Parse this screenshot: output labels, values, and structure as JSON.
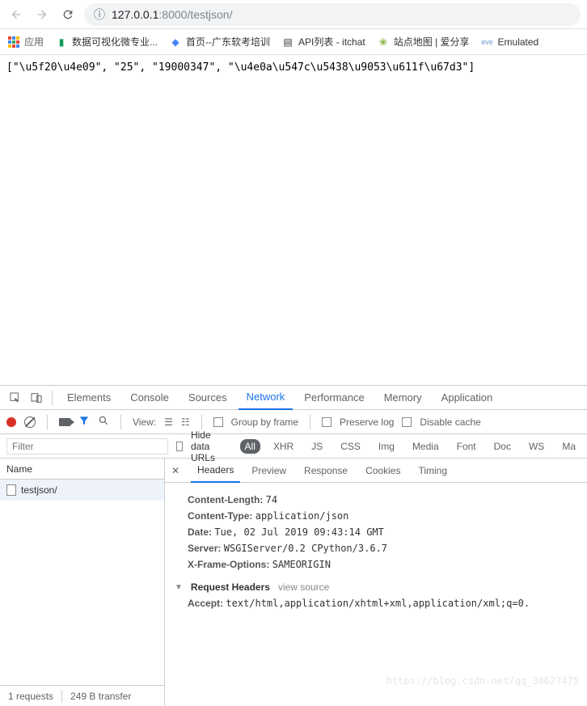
{
  "browser": {
    "url_host": "127.0.0.1",
    "url_path": ":8000/testjson/"
  },
  "bookmarks": {
    "apps_label": "应用",
    "items": [
      {
        "label": "数据可视化微专业...",
        "color": "#0f9d58"
      },
      {
        "label": "首页--广东软考培训",
        "color": "#4285f4"
      },
      {
        "label": "API列表 - itchat",
        "color": "#333"
      },
      {
        "label": "站点地图 | 爱分享",
        "color": "#8ab445"
      },
      {
        "label": "Emulated",
        "color": "#6b9bd2"
      }
    ]
  },
  "page_body": "[\"\\u5f20\\u4e09\", \"25\", \"19000347\", \"\\u4e0a\\u547c\\u5438\\u9053\\u611f\\u67d3\"]",
  "devtools": {
    "tabs": [
      "Elements",
      "Console",
      "Sources",
      "Network",
      "Performance",
      "Memory",
      "Application"
    ],
    "active_tab": "Network",
    "toolbar": {
      "view_label": "View:",
      "group_label": "Group by frame",
      "preserve_label": "Preserve log",
      "disable_label": "Disable cache"
    },
    "filter": {
      "placeholder": "Filter",
      "hide_urls": "Hide data URLs",
      "types": [
        "All",
        "XHR",
        "JS",
        "CSS",
        "Img",
        "Media",
        "Font",
        "Doc",
        "WS",
        "Ma"
      ]
    },
    "requests": {
      "header": "Name",
      "items": [
        "testjson/"
      ]
    },
    "detail_tabs": [
      "Headers",
      "Preview",
      "Response",
      "Cookies",
      "Timing"
    ],
    "headers": {
      "content_length": {
        "k": "Content-Length:",
        "v": "74"
      },
      "content_type": {
        "k": "Content-Type:",
        "v": "application/json"
      },
      "date": {
        "k": "Date:",
        "v": "Tue, 02 Jul 2019 09:43:14 GMT"
      },
      "server": {
        "k": "Server:",
        "v": "WSGIServer/0.2 CPython/3.6.7"
      },
      "xframe": {
        "k": "X-Frame-Options:",
        "v": "SAMEORIGIN"
      }
    },
    "request_section": {
      "title": "Request Headers",
      "view_source": "view source"
    },
    "accept": {
      "k": "Accept:",
      "v": "text/html,application/xhtml+xml,application/xml;q=0."
    },
    "status": {
      "requests": "1 requests",
      "transfer": "249 B transfer"
    }
  },
  "watermark": "https://blog.csdn.net/qq_38627475"
}
